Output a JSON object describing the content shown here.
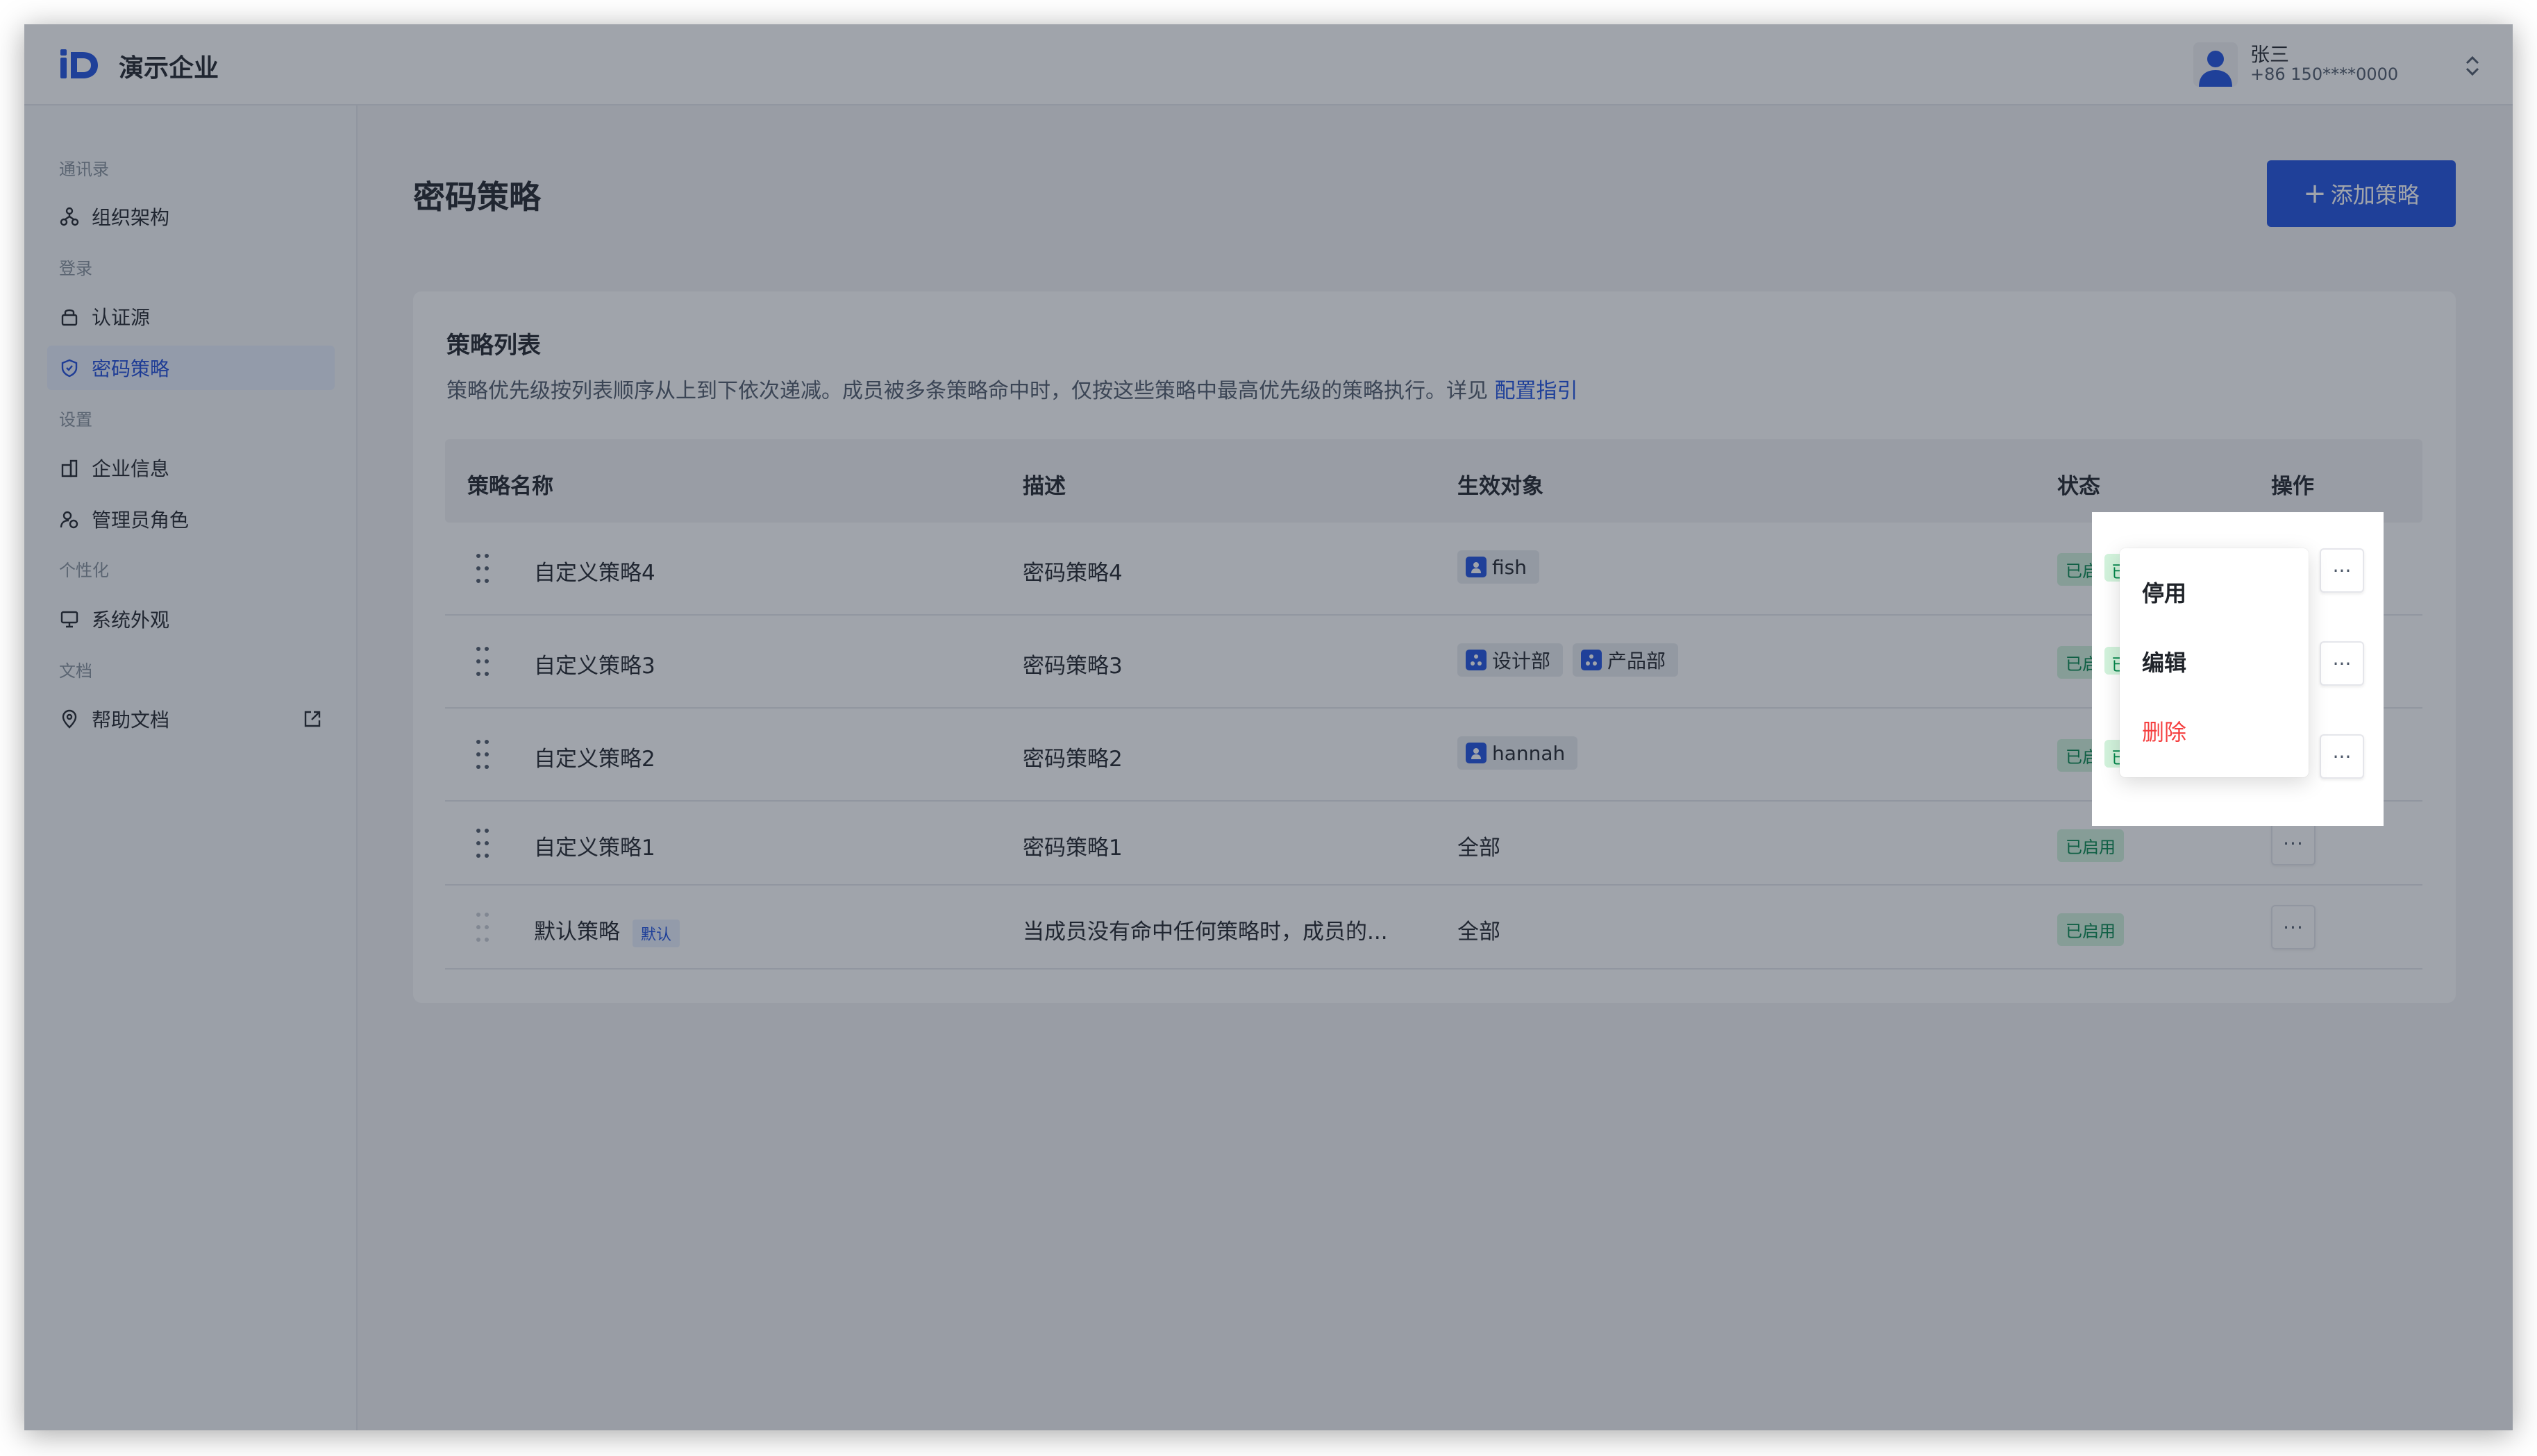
{
  "header": {
    "org_name": "演示企业",
    "user_name": "张三",
    "user_phone": "+86 150****0000"
  },
  "sidebar": {
    "groups": [
      {
        "title": "通讯录",
        "items": [
          {
            "label": "组织架构",
            "icon": "org-chart-icon"
          }
        ]
      },
      {
        "title": "登录",
        "items": [
          {
            "label": "认证源",
            "icon": "lock-icon"
          },
          {
            "label": "密码策略",
            "icon": "shield-icon",
            "active": true
          }
        ]
      },
      {
        "title": "设置",
        "items": [
          {
            "label": "企业信息",
            "icon": "building-icon"
          },
          {
            "label": "管理员角色",
            "icon": "admin-role-icon"
          }
        ]
      },
      {
        "title": "个性化",
        "items": [
          {
            "label": "系统外观",
            "icon": "monitor-icon"
          }
        ]
      },
      {
        "title": "文档",
        "items": [
          {
            "label": "帮助文档",
            "icon": "location-icon",
            "external": true
          }
        ]
      }
    ]
  },
  "main": {
    "title": "密码策略",
    "add_button_label": "添加策略",
    "card_title": "策略列表",
    "card_desc": "策略优先级按列表顺序从上到下依次递减。成员被多条策略命中时，仅按这些策略中最高优先级的策略执行。详见",
    "card_desc_link": "配置指引",
    "table": {
      "columns": [
        "策略名称",
        "描述",
        "生效对象",
        "状态",
        "操作"
      ],
      "rows": [
        {
          "name": "自定义策略4",
          "desc": "密码策略4",
          "targets": [
            {
              "label": "fish",
              "type": "user"
            }
          ],
          "status": "已启用"
        },
        {
          "name": "自定义策略3",
          "desc": "密码策略3",
          "targets": [
            {
              "label": "设计部",
              "type": "dept"
            },
            {
              "label": "产品部",
              "type": "dept"
            }
          ],
          "status": "已启用"
        },
        {
          "name": "自定义策略2",
          "desc": "密码策略2",
          "targets": [
            {
              "label": "hannah",
              "type": "user"
            }
          ],
          "status": "已启用"
        },
        {
          "name": "自定义策略1",
          "desc": "密码策略1",
          "target_text": "全部",
          "status": "已启用"
        },
        {
          "name": "默认策略",
          "badge": "默认",
          "desc": "当成员没有命中任何策略时，成员的...",
          "target_text": "全部",
          "status": "已启用"
        }
      ],
      "more_label": "···"
    },
    "dropdown": {
      "items": [
        "停用",
        "编辑",
        "删除"
      ],
      "status_fragment": "已"
    }
  },
  "colors": {
    "primary": "#1d4fe0",
    "danger": "#f53f3f",
    "success_text": "#00864a",
    "success_bg": "#d2f3dc",
    "overlay": "rgba(35,45,60,0.43)"
  }
}
